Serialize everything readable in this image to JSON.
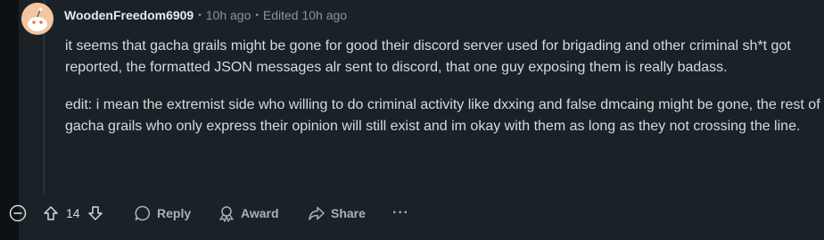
{
  "comment": {
    "author": "WoodenFreedom6909",
    "posted": "10h ago",
    "edited": "Edited 10h ago",
    "paragraphs": [
      "it seems that gacha grails might be gone for good their discord server used for brigading and other criminal sh*t got reported, the formatted JSON messages alr sent to discord, that one guy exposing them is really badass.",
      "edit: i mean the extremist side who willing to do criminal activity like dxxing and false dmcaing might be gone, the rest of gacha grails who only express their opinion will still exist and im okay with them as long as they not crossing the line."
    ]
  },
  "actions": {
    "score": "14",
    "reply_label": "Reply",
    "award_label": "Award",
    "share_label": "Share",
    "more_label": "···"
  },
  "icons": {
    "collapse": "minus-circle-icon",
    "upvote": "arrow-up-icon",
    "downvote": "arrow-down-icon",
    "reply": "speech-bubble-icon",
    "award": "award-ribbon-icon",
    "share": "share-arrow-icon"
  },
  "colors": {
    "background": "#1b2227",
    "text": "#d7dadc",
    "muted": "#8d9499",
    "avatar": "#f2c6a0"
  }
}
